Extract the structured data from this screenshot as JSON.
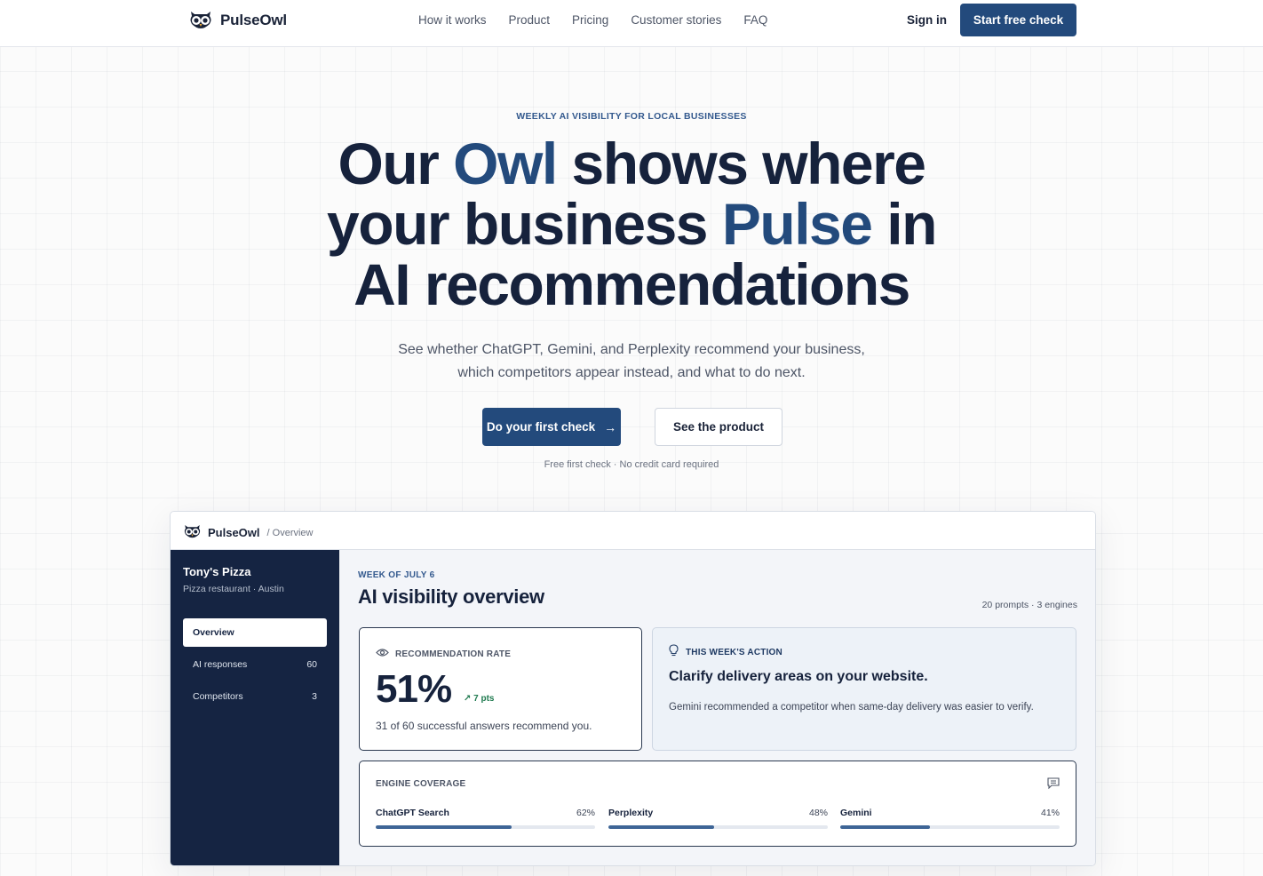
{
  "nav": {
    "brand": "PulseOwl",
    "links": [
      "How it works",
      "Product",
      "Pricing",
      "Customer stories",
      "FAQ"
    ],
    "signin": "Sign in",
    "cta": "Start free check"
  },
  "hero": {
    "eyebrow": "WEEKLY AI VISIBILITY FOR LOCAL BUSINESSES",
    "headline": {
      "l1a": "Our ",
      "l1b": "Owl",
      "l1c": " shows where",
      "l2a": "your business ",
      "l2b": "Pulse",
      "l2c": " in",
      "l3": "AI recommendations"
    },
    "sub_line1": "See whether ChatGPT, Gemini, and Perplexity recommend your business,",
    "sub_line2": "which competitors appear instead, and what to do next.",
    "primary_cta": "Do your first check",
    "secondary_cta": "See the product",
    "note": "Free first check · No credit card required"
  },
  "app": {
    "brand": "PulseOwl",
    "breadcrumb": "/ Overview",
    "business": "Tony's Pizza",
    "business_sub": "Pizza restaurant · Austin",
    "sidebar": [
      {
        "label": "Overview",
        "count": "",
        "active": true
      },
      {
        "label": "AI responses",
        "count": "60",
        "active": false
      },
      {
        "label": "Competitors",
        "count": "3",
        "active": false
      }
    ],
    "week": "WEEK OF JULY 6",
    "title": "AI visibility overview",
    "meta": "20 prompts · 3 engines",
    "rate": {
      "label": "RECOMMENDATION RATE",
      "value": "51%",
      "delta": "↗ 7 pts",
      "desc": "31 of 60 successful answers recommend you."
    },
    "action": {
      "label": "THIS WEEK'S ACTION",
      "headline": "Clarify delivery areas on your website.",
      "desc": "Gemini recommended a competitor when same-day delivery was easier to verify."
    },
    "engines": {
      "label": "ENGINE COVERAGE",
      "items": [
        {
          "name": "ChatGPT Search",
          "pct": "62%",
          "value": 62
        },
        {
          "name": "Perplexity",
          "pct": "48%",
          "value": 48
        },
        {
          "name": "Gemini",
          "pct": "41%",
          "value": 41
        }
      ]
    }
  },
  "colors": {
    "brand_navy": "#234a7c",
    "sidebar_bg": "#152442",
    "accent_green": "#1f7a4f"
  }
}
